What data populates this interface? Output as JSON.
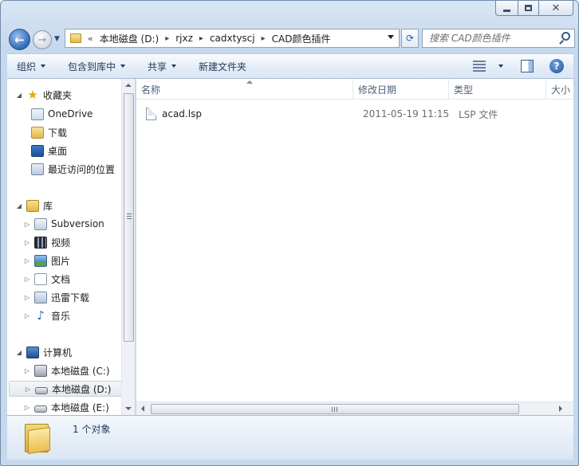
{
  "address": {
    "chevron": "«",
    "path": [
      "本地磁盘 (D:)",
      "rjxz",
      "cadxtyscj",
      "CAD颜色插件"
    ]
  },
  "search": {
    "placeholder": "搜索 CAD颜色插件"
  },
  "toolbar": {
    "organize": "组织",
    "include_in_library": "包含到库中",
    "share": "共享",
    "new_folder": "新建文件夹"
  },
  "nav": {
    "favorites": "收藏夹",
    "onedrive": "OneDrive",
    "downloads": "下载",
    "desktop": "桌面",
    "recent": "最近访问的位置",
    "libraries": "库",
    "subversion": "Subversion",
    "videos": "视频",
    "pictures": "图片",
    "documents": "文档",
    "thunder": "迅雷下载",
    "music": "音乐",
    "computer": "计算机",
    "drive_c": "本地磁盘 (C:)",
    "drive_d": "本地磁盘 (D:)",
    "drive_e": "本地磁盘 (E:)"
  },
  "columns": {
    "name": "名称",
    "modified": "修改日期",
    "type": "类型",
    "size": "大小"
  },
  "files": [
    {
      "name": "acad.lsp",
      "modified": "2011-05-19 11:15",
      "type": "LSP 文件"
    }
  ],
  "status": {
    "count": "1 个对象"
  },
  "icons": {
    "back": "back-arrow-icon",
    "forward": "forward-arrow-icon",
    "refresh": "refresh-icon",
    "search": "search-icon",
    "help": "help-icon"
  }
}
